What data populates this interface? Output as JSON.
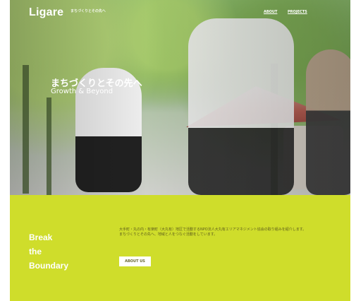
{
  "header": {
    "logo": "Ligare",
    "tagline": "まちづくりとその先へ",
    "nav_links": [
      "ABOUT",
      "PROJECTS"
    ]
  },
  "hero": {
    "title": "まちづくりとその先へ",
    "subtitle": "Growth & Beyond"
  },
  "section": {
    "heading_lines": [
      "Break",
      "the",
      "Boundary"
    ],
    "description": "大手町・丸の内・有楽町（大丸有）地区で活動するNPO法人大丸有エリアマネジメント協会の取り組みを紹介します。まちづくりとその先へ、地域と人をつなぐ活動をしています。",
    "button_label": "ABOUT US"
  },
  "colors": {
    "accent": "#cfdd2b",
    "text_white": "#ffffff"
  }
}
